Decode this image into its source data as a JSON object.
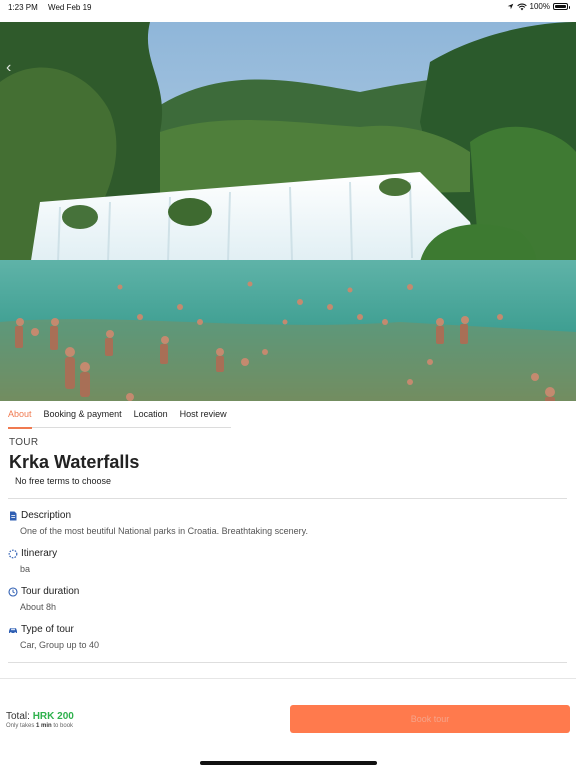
{
  "status_bar": {
    "time": "1:23 PM",
    "date": "Wed Feb 19",
    "battery_text": "100%",
    "battery_level": 1.0,
    "icons": [
      "wifi-icon",
      "location-arrow-icon",
      "battery-icon"
    ]
  },
  "hero": {
    "image_subject": "waterfall-photo",
    "back_icon": "chevron-left-icon"
  },
  "tabs": [
    {
      "label": "About",
      "active": true
    },
    {
      "label": "Booking & payment",
      "active": false
    },
    {
      "label": "Location",
      "active": false
    },
    {
      "label": "Host review",
      "active": false
    }
  ],
  "tour": {
    "kind": "TOUR",
    "title": "Krka Waterfalls",
    "terms": "No free terms to choose"
  },
  "details": [
    {
      "icon": "document-icon",
      "heading": "Description",
      "value": "One of the most beutiful National parks in Croatia. Breathtaking scenery."
    },
    {
      "icon": "itinerary-icon",
      "heading": "Itinerary",
      "value": "ba"
    },
    {
      "icon": "clock-icon",
      "heading": "Tour duration",
      "value": "About 8h"
    },
    {
      "icon": "car-icon",
      "heading": "Type of tour",
      "value": "Car, Group up to 40"
    }
  ],
  "footer": {
    "total_label": "Total:",
    "total_amount": "HRK 200",
    "hint_prefix": "Only takes ",
    "hint_bold": "1 min",
    "hint_suffix": " to book",
    "book_button": "Book tour"
  },
  "colors": {
    "accent": "#f07a50",
    "button": "#ff7a4d",
    "price": "#2eb14c",
    "icon_blue": "#2f5fb3"
  }
}
